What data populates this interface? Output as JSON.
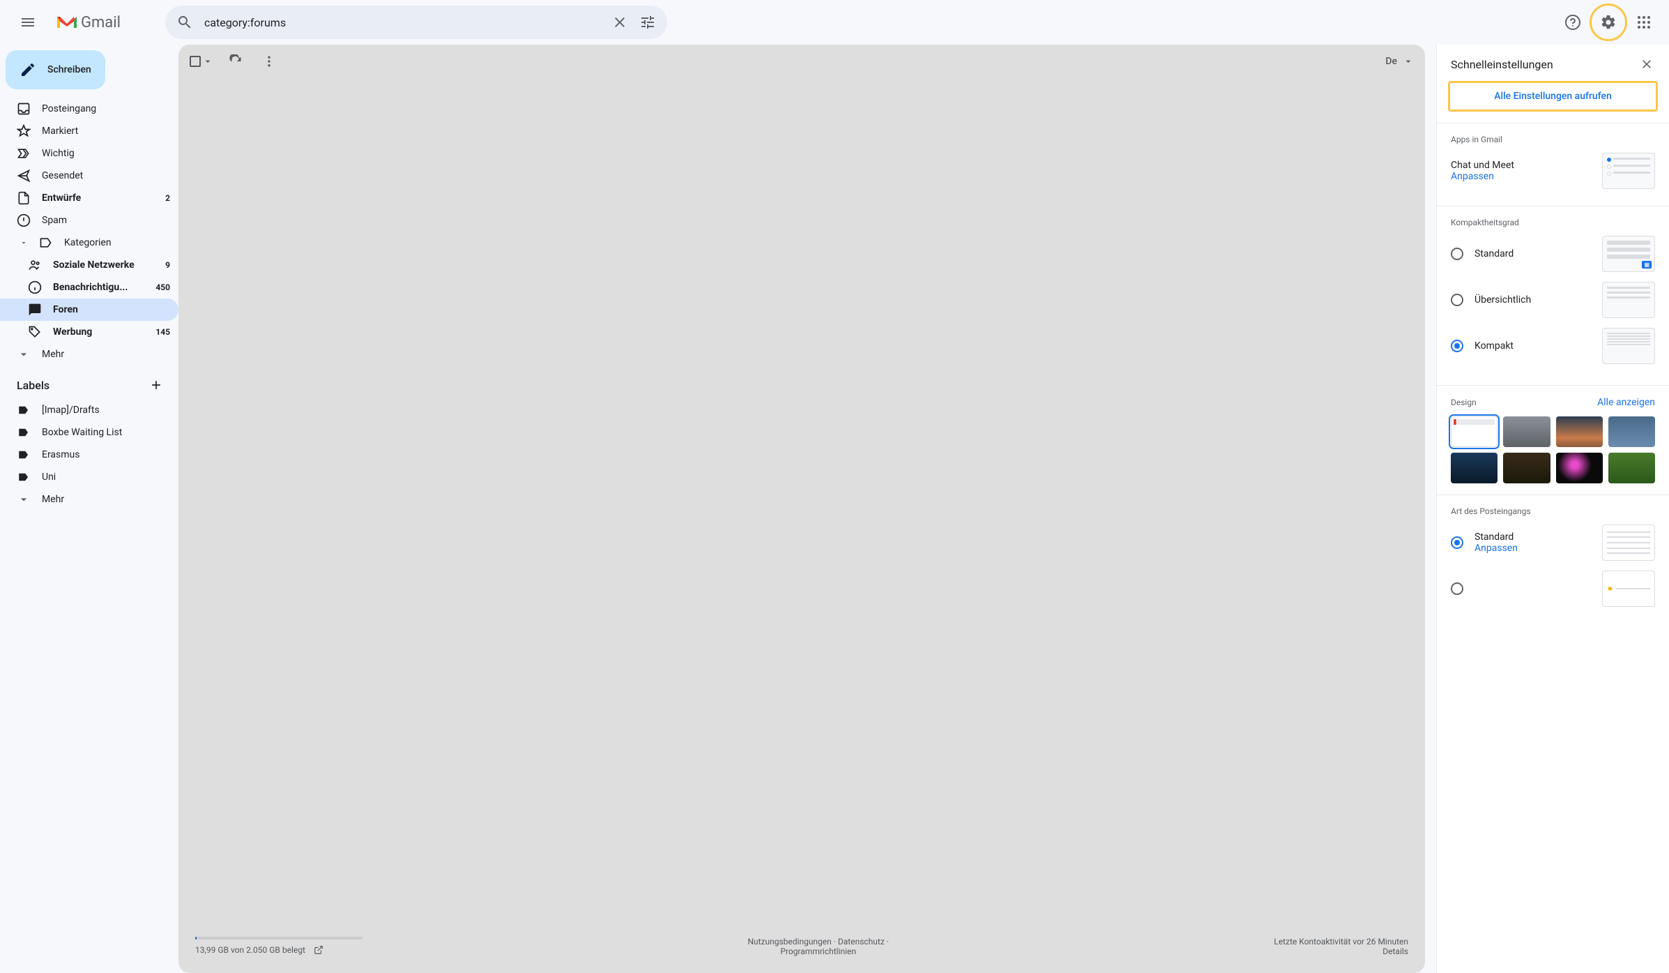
{
  "header": {
    "logo_text": "Gmail",
    "search_value": "category:forums"
  },
  "compose_label": "Schreiben",
  "nav": {
    "inbox": "Posteingang",
    "starred": "Markiert",
    "important": "Wichtig",
    "sent": "Gesendet",
    "drafts": "Entwürfe",
    "drafts_count": "2",
    "spam": "Spam",
    "categories": "Kategorien",
    "social": "Soziale Netzwerke",
    "social_count": "9",
    "updates": "Benachrichtigu...",
    "updates_count": "450",
    "forums": "Foren",
    "promotions": "Werbung",
    "promotions_count": "145",
    "more": "Mehr"
  },
  "labels_header": "Labels",
  "labels": {
    "l1": "[Imap]/Drafts",
    "l2": "Boxbe Waiting List",
    "l3": "Erasmus",
    "l4": "Uni",
    "more": "Mehr"
  },
  "toolbar": {
    "lang": "De"
  },
  "footer": {
    "storage": "13,99 GB von 2.050 GB belegt",
    "terms": "Nutzungsbedingungen",
    "privacy": "Datenschutz",
    "program": "Programmrichtlinien",
    "activity": "Letzte Kontoaktivität vor 26 Minuten",
    "details": "Details"
  },
  "settings": {
    "title": "Schnelleinstellungen",
    "all_settings": "Alle Einstellungen aufrufen",
    "apps_title": "Apps in Gmail",
    "chat_meet": "Chat und Meet",
    "customize": "Anpassen",
    "density_title": "Kompaktheitsgrad",
    "density_standard": "Standard",
    "density_comfortable": "Übersichtlich",
    "density_compact": "Kompakt",
    "design_title": "Design",
    "show_all": "Alle anzeigen",
    "inbox_type_title": "Art des Posteingangs",
    "inbox_standard": "Standard",
    "inbox_customize": "Anpassen"
  }
}
